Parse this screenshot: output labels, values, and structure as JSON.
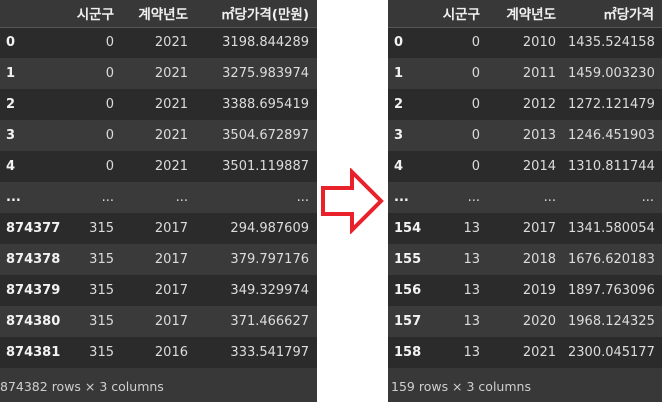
{
  "left_table": {
    "columns": [
      "시군구",
      "계약년도",
      "㎡당가격(만원)"
    ],
    "rows": [
      {
        "index": "0",
        "cells": [
          "0",
          "2021",
          "3198.844289"
        ]
      },
      {
        "index": "1",
        "cells": [
          "0",
          "2021",
          "3275.983974"
        ]
      },
      {
        "index": "2",
        "cells": [
          "0",
          "2021",
          "3388.695419"
        ]
      },
      {
        "index": "3",
        "cells": [
          "0",
          "2021",
          "3504.672897"
        ]
      },
      {
        "index": "4",
        "cells": [
          "0",
          "2021",
          "3501.119887"
        ]
      },
      {
        "index": "...",
        "cells": [
          "...",
          "...",
          "..."
        ]
      },
      {
        "index": "874377",
        "cells": [
          "315",
          "2017",
          "294.987609"
        ]
      },
      {
        "index": "874378",
        "cells": [
          "315",
          "2017",
          "379.797176"
        ]
      },
      {
        "index": "874379",
        "cells": [
          "315",
          "2017",
          "349.329974"
        ]
      },
      {
        "index": "874380",
        "cells": [
          "315",
          "2017",
          "371.466627"
        ]
      },
      {
        "index": "874381",
        "cells": [
          "315",
          "2016",
          "333.541797"
        ]
      }
    ],
    "shape_text": "874382 rows × 3 columns"
  },
  "right_table": {
    "columns": [
      "시군구",
      "계약년도",
      "㎡당가격"
    ],
    "rows": [
      {
        "index": "0",
        "cells": [
          "0",
          "2010",
          "1435.524158"
        ]
      },
      {
        "index": "1",
        "cells": [
          "0",
          "2011",
          "1459.003230"
        ]
      },
      {
        "index": "2",
        "cells": [
          "0",
          "2012",
          "1272.121479"
        ]
      },
      {
        "index": "3",
        "cells": [
          "0",
          "2013",
          "1246.451903"
        ]
      },
      {
        "index": "4",
        "cells": [
          "0",
          "2014",
          "1310.811744"
        ]
      },
      {
        "index": "...",
        "cells": [
          "...",
          "...",
          "..."
        ]
      },
      {
        "index": "154",
        "cells": [
          "13",
          "2017",
          "1341.580054"
        ]
      },
      {
        "index": "155",
        "cells": [
          "13",
          "2018",
          "1676.620183"
        ]
      },
      {
        "index": "156",
        "cells": [
          "13",
          "2019",
          "1897.763096"
        ]
      },
      {
        "index": "157",
        "cells": [
          "13",
          "2020",
          "1968.124325"
        ]
      },
      {
        "index": "158",
        "cells": [
          "13",
          "2021",
          "2300.045177"
        ]
      }
    ],
    "shape_text": "159 rows × 3 columns"
  },
  "arrow": {
    "icon": "right-arrow-icon",
    "stroke_color": "#e8212a",
    "fill_color": "#ffffff"
  },
  "theme": {
    "panel_bg": "#383838",
    "row_dark": "#2b2b2b",
    "row_light": "#3a3a3a"
  }
}
